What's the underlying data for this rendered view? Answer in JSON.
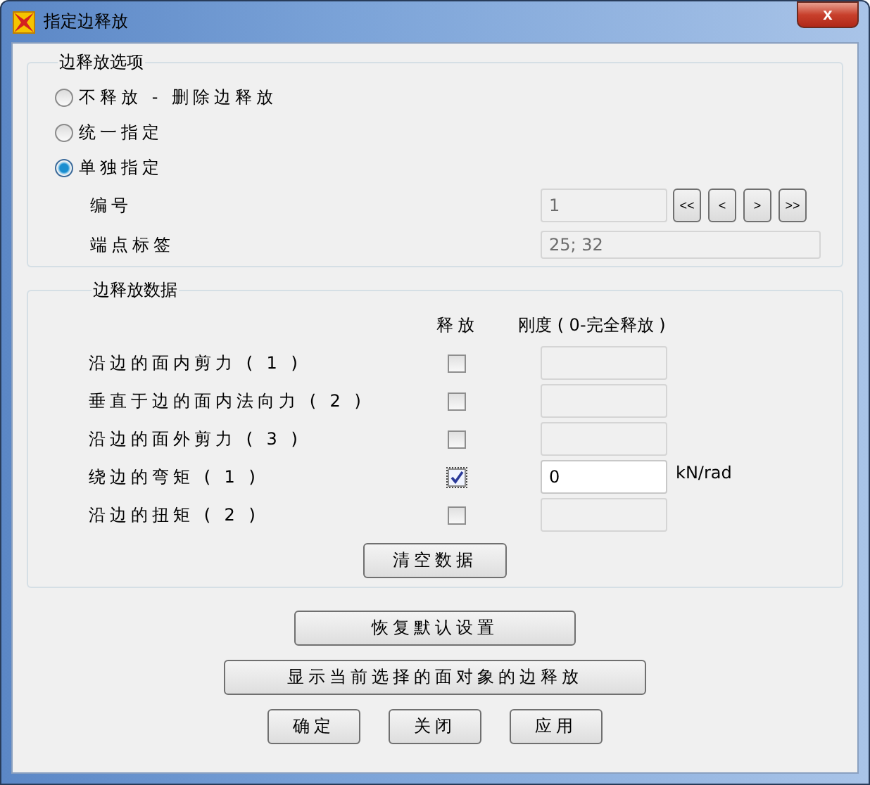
{
  "window": {
    "title": "指定边释放",
    "close": "x"
  },
  "options_group": {
    "title": "边释放选项",
    "radios": [
      {
        "label": "不释放 - 删除边释放",
        "selected": false
      },
      {
        "label": "统一指定",
        "selected": false
      },
      {
        "label": "单独指定",
        "selected": true
      }
    ],
    "number_label": "编号",
    "number_value": "1",
    "nav_buttons": [
      "<<",
      "<",
      ">",
      ">>"
    ],
    "endpoint_label": "端点标签",
    "endpoint_value": "25;  32"
  },
  "data_group": {
    "title": "边释放数据",
    "release_header": "释放",
    "stiffness_header": "刚度 ( 0-完全释放 )",
    "rows": [
      {
        "label": "沿边的面内剪力 ( 1 )",
        "checked": false
      },
      {
        "label": "垂直于边的面内法向力 ( 2 )",
        "checked": false
      },
      {
        "label": "沿边的面外剪力 ( 3 )",
        "checked": false
      },
      {
        "label": "绕边的弯矩 ( 1 )",
        "checked": true,
        "value": "0",
        "unit": "kN/rad"
      },
      {
        "label": "沿边的扭矩 ( 2 )",
        "checked": false
      }
    ],
    "clear_button": "清空数据"
  },
  "buttons": {
    "restore": "恢复默认设置",
    "show": "显示当前选择的面对象的边释放",
    "actions": [
      "确定",
      "关闭",
      "应用"
    ]
  }
}
